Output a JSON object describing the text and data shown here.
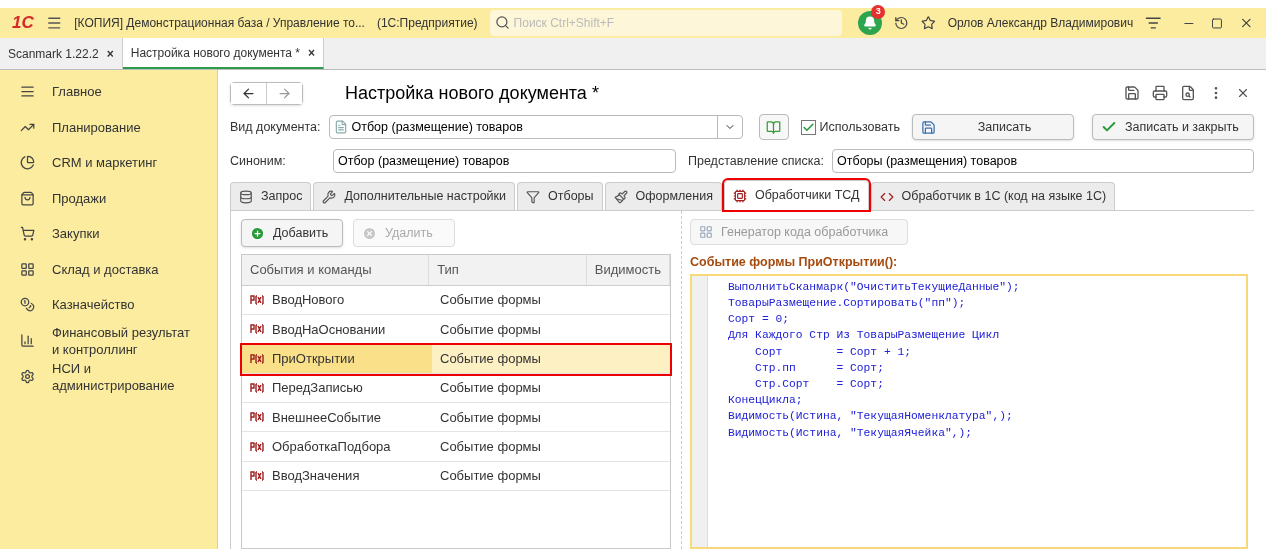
{
  "app_bar": {
    "logo": "1С",
    "title": "[КОПИЯ] Демонстрационная база / Управление то...",
    "platform": "(1С:Предприятие)",
    "search": {
      "placeholder": "Поиск Ctrl+Shift+F"
    },
    "notifications": "3",
    "user": "Орлов Александр Владимирович"
  },
  "open_tabs": [
    {
      "label": "Scanmark 1.22.2",
      "close": "×",
      "selected": false
    },
    {
      "label": "Настройка нового документа *",
      "close": "×",
      "selected": true
    }
  ],
  "sidebar": {
    "items": [
      {
        "label": "Главное"
      },
      {
        "label": "Планирование"
      },
      {
        "label": "CRM и маркетинг"
      },
      {
        "label": "Продажи"
      },
      {
        "label": "Закупки"
      },
      {
        "label": "Склад и доставка"
      },
      {
        "label": "Казначейство"
      },
      {
        "label": "Финансовый результат и контроллинг"
      },
      {
        "label": "НСИ и администрирование"
      }
    ]
  },
  "form": {
    "title": "Настройка нового документа *",
    "doc_type": {
      "label": "Вид документа:",
      "value": "Отбор (размещение) товаров"
    },
    "use": {
      "label": "Использовать",
      "checked": true
    },
    "buttons": [
      {
        "label": "Записать",
        "kind": "save"
      },
      {
        "label": "Записать и закрыть",
        "kind": "check"
      }
    ],
    "synonym": {
      "label": "Синоним:",
      "value": "Отбор (размещение) товаров"
    },
    "list_view": {
      "label": "Представление списка:",
      "value": "Отборы (размещения) товаров"
    },
    "tabs": [
      {
        "label": "Запрос",
        "selected": false,
        "annotated": false
      },
      {
        "label": "Дополнительные настройки",
        "selected": false,
        "annotated": false
      },
      {
        "label": "Отборы",
        "selected": false,
        "annotated": false
      },
      {
        "label": "Оформления",
        "selected": false,
        "annotated": false
      },
      {
        "label": "Обработчики ТСД",
        "selected": true,
        "annotated": true
      },
      {
        "label": "Обработчик в 1С (код на языке 1С)",
        "selected": false,
        "annotated": false
      }
    ],
    "list_buttons": [
      {
        "label": "Добавить",
        "disabled": false
      },
      {
        "label": "Удалить",
        "disabled": true
      }
    ],
    "table": {
      "columns": [
        "События и команды",
        "Тип",
        "Видимость"
      ],
      "rows": [
        {
          "name": "ВводНового",
          "type": "Событие формы",
          "selected": false,
          "annotated": false
        },
        {
          "name": "ВводНаОсновании",
          "type": "Событие формы",
          "selected": false,
          "annotated": false
        },
        {
          "name": "ПриОткрытии",
          "type": "Событие формы",
          "selected": true,
          "annotated": true
        },
        {
          "name": "ПередЗаписью",
          "type": "Событие формы",
          "selected": false,
          "annotated": false
        },
        {
          "name": "ВнешнееСобытие",
          "type": "Событие формы",
          "selected": false,
          "annotated": false
        },
        {
          "name": "ОбработкаПодбора",
          "type": "Событие формы",
          "selected": false,
          "annotated": false
        },
        {
          "name": "ВводЗначения",
          "type": "Событие формы",
          "selected": false,
          "annotated": false
        }
      ]
    },
    "generator": {
      "label": "Генератор кода обработчика",
      "disabled": true
    },
    "code_heading": "Событие формы ПриОткрытии():",
    "code": [
      "ВыполнитьСканмарк(\"ОчиститьТекущиеДанные\");",
      "ТоварыРазмещение.Сортировать(\"пп\");",
      "Сорт = 0;",
      "Для Каждого Стр Из ТоварыРазмещение Цикл",
      "    Сорт        = Сорт + 1;",
      "    Стр.пп      = Сорт;",
      "    Стр.Сорт    = Сорт;",
      "КонецЦикла;",
      "Видимость(Истина, \"ТекущаяНоменклатура\",);",
      "Видимость(Истина, \"ТекущаяЯчейка\",);"
    ]
  }
}
